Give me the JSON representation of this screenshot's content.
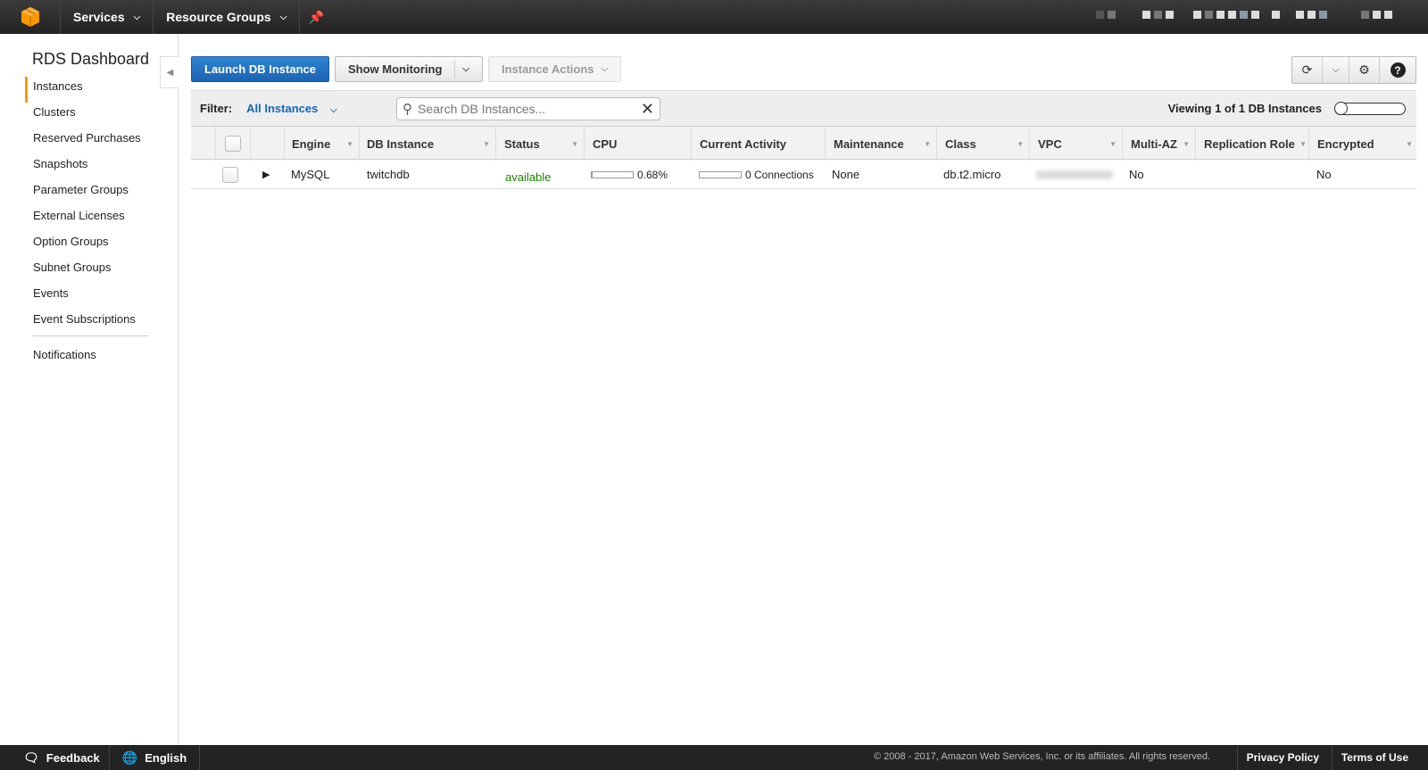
{
  "topnav": {
    "services_label": "Services",
    "resource_groups_label": "Resource Groups"
  },
  "sidebar": {
    "title": "RDS Dashboard",
    "items": [
      {
        "label": "Instances"
      },
      {
        "label": "Clusters"
      },
      {
        "label": "Reserved Purchases"
      },
      {
        "label": "Snapshots"
      },
      {
        "label": "Parameter Groups"
      },
      {
        "label": "External Licenses"
      },
      {
        "label": "Option Groups"
      },
      {
        "label": "Subnet Groups"
      },
      {
        "label": "Events"
      },
      {
        "label": "Event Subscriptions"
      }
    ],
    "notifications_label": "Notifications"
  },
  "toolbar": {
    "launch_label": "Launch DB Instance",
    "show_monitoring_label": "Show Monitoring",
    "instance_actions_label": "Instance Actions"
  },
  "filter": {
    "label": "Filter:",
    "value": "All Instances",
    "search_placeholder": "Search DB Instances...",
    "viewing_text": "Viewing 1 of 1 DB Instances"
  },
  "table": {
    "columns": {
      "engine": "Engine",
      "db_instance": "DB Instance",
      "status": "Status",
      "cpu": "CPU",
      "current_activity": "Current Activity",
      "maintenance": "Maintenance",
      "class": "Class",
      "vpc": "VPC",
      "multi_az": "Multi-AZ",
      "replication_role": "Replication Role",
      "encrypted": "Encrypted"
    },
    "rows": [
      {
        "engine": "MySQL",
        "db_instance": "twitchdb",
        "status": "available",
        "cpu": "0.68%",
        "cpu_fraction": 0.0068,
        "current_activity": "0 Connections",
        "maintenance": "None",
        "class": "db.t2.micro",
        "multi_az": "No",
        "replication_role": "",
        "encrypted": "No"
      }
    ]
  },
  "footer": {
    "feedback_label": "Feedback",
    "language_label": "English",
    "copyright": "© 2008 - 2017, Amazon Web Services, Inc. or its affiliates. All rights reserved.",
    "privacy_label": "Privacy Policy",
    "terms_label": "Terms of Use"
  },
  "colors": {
    "accent_orange": "#ff9900",
    "primary_blue": "#1c63b3",
    "status_green": "#1d8102",
    "link_blue": "#1166bb"
  }
}
